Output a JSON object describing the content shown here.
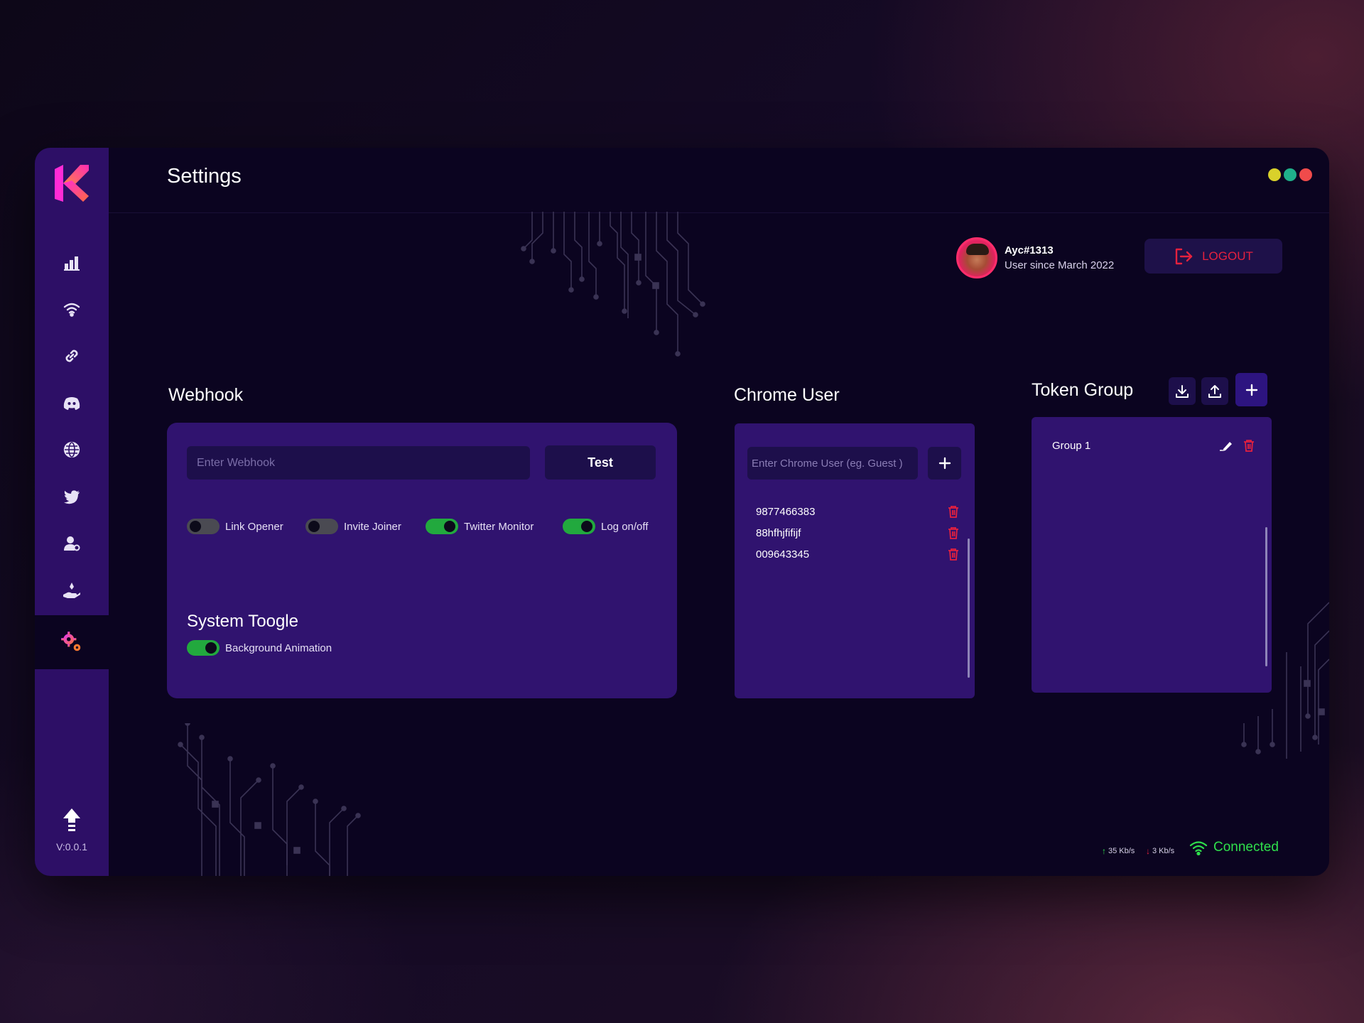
{
  "app": {
    "title": "Settings",
    "version": "V:0.0.1"
  },
  "colors": {
    "accent": "#30136f",
    "sidebar": "#2d0f66",
    "danger": "#e5213e",
    "success": "#22a93e",
    "connected": "#2fe04c"
  },
  "window_controls": [
    {
      "name": "minimize",
      "color": "#d9d12b"
    },
    {
      "name": "maximize",
      "color": "#1fb08a"
    },
    {
      "name": "close",
      "color": "#f04b4b"
    }
  ],
  "sidebar": {
    "items": [
      {
        "icon": "chart-icon",
        "label": "Dashboard"
      },
      {
        "icon": "wifi-icon",
        "label": "Monitor"
      },
      {
        "icon": "link-icon",
        "label": "Link"
      },
      {
        "icon": "discord-icon",
        "label": "Discord"
      },
      {
        "icon": "globe-icon",
        "label": "Web"
      },
      {
        "icon": "twitter-icon",
        "label": "Twitter"
      },
      {
        "icon": "user-icon",
        "label": "Accounts"
      },
      {
        "icon": "hand-icon",
        "label": "Giveaway"
      },
      {
        "icon": "gear-icon",
        "label": "Settings",
        "active": true
      }
    ]
  },
  "user": {
    "name": "Ayc#1313",
    "since": "User since March 2022",
    "logout_label": "LOGOUT"
  },
  "webhook": {
    "title": "Webhook",
    "placeholder": "Enter Webhook",
    "test_label": "Test",
    "toggles": [
      {
        "label": "Link Opener",
        "on": false
      },
      {
        "label": "Invite Joiner",
        "on": false
      },
      {
        "label": "Twitter Monitor",
        "on": true
      },
      {
        "label": "Log on/off",
        "on": true
      }
    ],
    "system_title": "System Toogle",
    "system_toggle": {
      "label": "Background Animation",
      "on": true
    }
  },
  "chrome": {
    "title": "Chrome User",
    "placeholder": "Enter Chrome User (eg. Guest )",
    "users": [
      "9877466383",
      "88hfhjfifijf",
      "009643345"
    ]
  },
  "tokens": {
    "title": "Token Group",
    "groups": [
      "Group 1"
    ]
  },
  "status": {
    "upload": "35 Kb/s",
    "download": "3 Kb/s",
    "connection": "Connected"
  }
}
